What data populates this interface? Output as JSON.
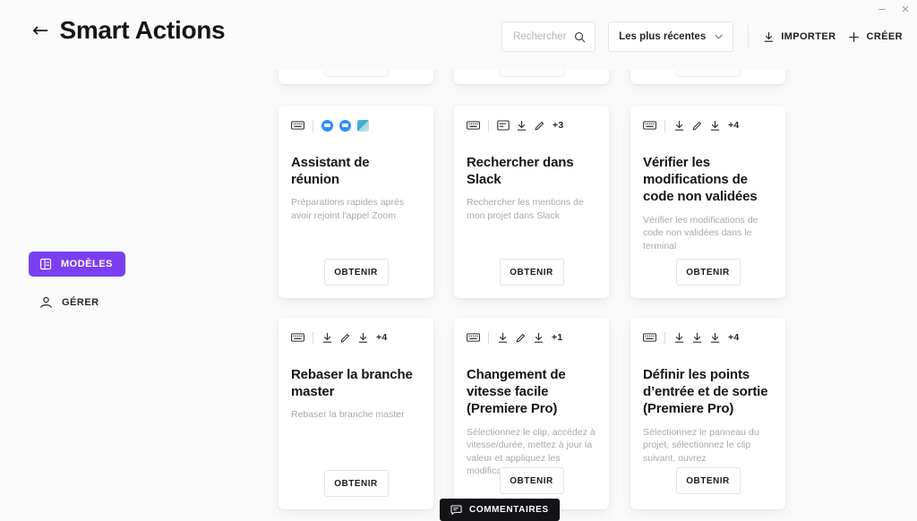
{
  "window": {
    "minimize_label": "–",
    "close_label": "✕"
  },
  "header": {
    "back_label": "←",
    "title": "Smart Actions"
  },
  "toolbar": {
    "search_placeholder": "Rechercher",
    "search_value": "",
    "search_icon": "search-icon",
    "sort_value": "Les plus récentes",
    "sort_chevron": "⌄",
    "import_label": "IMPORTER",
    "create_label": "CRÉER",
    "accent_purple": "#7b3ff2"
  },
  "sidebar": {
    "items": [
      {
        "label": "MODÈLES",
        "icon": "template-list-icon",
        "active": true
      },
      {
        "label": "GÉRER",
        "icon": "person-icon",
        "active": false
      }
    ]
  },
  "cards": {
    "get_label": "OBTENIR",
    "row1": [
      {
        "title": "Assistant de réunion",
        "description": "Préparations rapides après avoir rejoint l'appel Zoom",
        "icons": [
          "keyboard-icon",
          "zoom-app-icon",
          "zoom-app-icon",
          "app-tile-icon"
        ],
        "extra_count": ""
      },
      {
        "title": "Rechercher dans Slack",
        "description": "Rechercher les mentions de mon projet dans Slack",
        "icons": [
          "keyboard-icon",
          "note-icon",
          "download-icon",
          "pencil-icon"
        ],
        "extra_count": "+3"
      },
      {
        "title": "Vérifier les modifications de code non validées",
        "description": "Vérifier les modifications de code non validées dans le terminal",
        "icons": [
          "keyboard-icon",
          "download-icon",
          "pencil-icon",
          "download-icon"
        ],
        "extra_count": "+4"
      }
    ],
    "row2": [
      {
        "title": "Rebaser la branche master",
        "description": "Rebaser la branche master",
        "icons": [
          "keyboard-icon",
          "download-icon",
          "pencil-icon",
          "download-icon"
        ],
        "extra_count": "+4"
      },
      {
        "title": "Changement de vitesse facile (Premiere Pro)",
        "description": "Sélectionnez le clip, accédez à vitesse/durée, mettez à jour la valeur et appliquez les modifications",
        "icons": [
          "keyboard-icon",
          "download-icon",
          "pencil-icon",
          "download-icon"
        ],
        "extra_count": "+1"
      },
      {
        "title": "Définir les points d’entrée et de sortie (Premiere Pro)",
        "description": "Sélectionnez le panneau du projet, sélectionnez le clip suivant, ouvrez",
        "icons": [
          "keyboard-icon",
          "download-icon",
          "download-icon",
          "download-icon"
        ],
        "extra_count": "+4"
      }
    ]
  },
  "comments": {
    "label": "COMMENTAIRES",
    "icon": "comment-bubble-icon"
  }
}
